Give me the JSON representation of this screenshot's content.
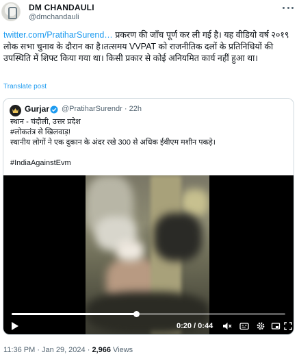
{
  "author": {
    "name": "DM CHANDAULI",
    "handle": "@dmchandauli"
  },
  "tweet": {
    "link_text": "twitter.com/PratiharSurend…",
    "text_after_link": " प्रकरण की जाँच पूर्ण कर ली गई है। यह वीडियो वर्ष २०१९ लोक सभा चुनाव के दौरान का है।तत्समय VVPAT को राजनीतिक दलों के प्रतिनिधियों  की उपस्थिति में शिफ्ट किया गया था। किसी प्रकार से कोई अनियमित कार्य नहीं हुआ था।",
    "translate_label": "Translate post"
  },
  "quoted": {
    "name": "Gurjar",
    "handle_time": "@PratiharSurendr · 22h",
    "lines": [
      "स्थान - चंदौली, उत्तर प्रदेश",
      "#लोकतंत्र से खिलवाड़!",
      "स्थानीय लोगों ने एक दुकान के अंदर रखे 300 से अधिक ईवीएम मशीन पकड़े।"
    ],
    "hashtag": "#IndiaAgainstEvm"
  },
  "video": {
    "time": "0:20 / 0:44",
    "progress_fraction": 0.455,
    "icons": [
      "play-icon",
      "mute-icon",
      "captions-icon",
      "settings-icon",
      "fullscreen-icon",
      "expand-icon"
    ]
  },
  "meta": {
    "timestamp": "11:36 PM · Jan 29, 2024 · ",
    "views_count": "2,966",
    "views_label": " Views"
  },
  "colors": {
    "link": "#1d9bf0",
    "secondary_text": "#536471",
    "border": "#cfd9de"
  }
}
